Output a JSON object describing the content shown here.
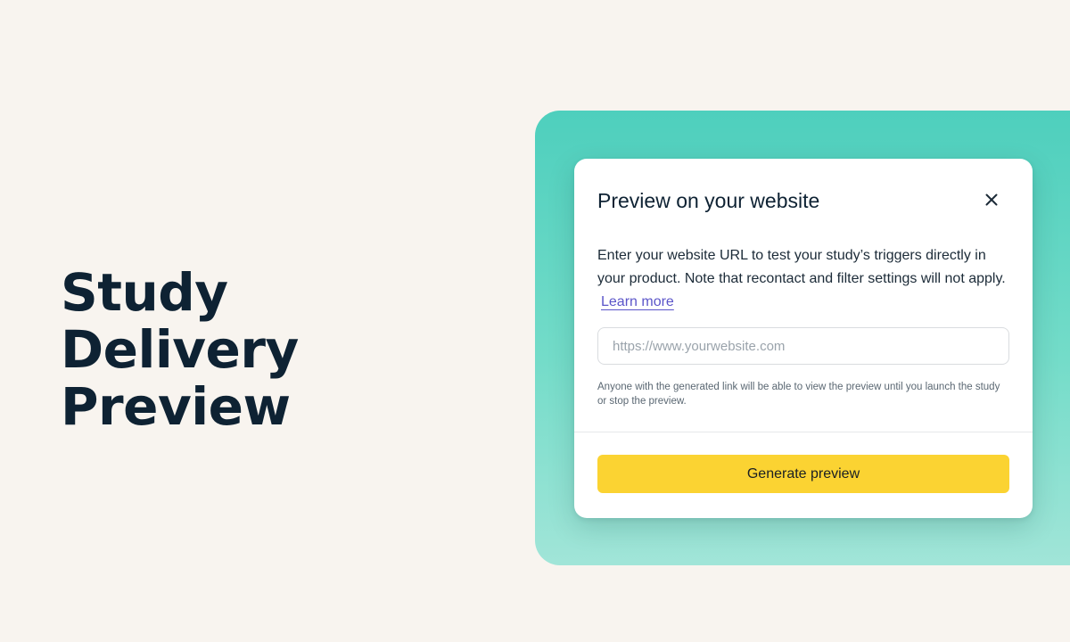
{
  "hero": {
    "title": "Study Delivery Preview"
  },
  "modal": {
    "title": "Preview on your website",
    "description": "Enter your website URL to test your study’s triggers directly in your product. Note that recontact and filter settings will not apply.",
    "learn_more_label": "Learn more",
    "url_input": {
      "value": "",
      "placeholder": "https://www.yourwebsite.com"
    },
    "helper_text": "Anyone with the generated link will be able to view the preview until you launch the study or stop the preview.",
    "generate_button_label": "Generate preview"
  },
  "colors": {
    "page_background": "#f8f4ef",
    "panel_teal": "#4ecfbd",
    "primary_button": "#fbd332",
    "link": "#5b55c9",
    "text_dark": "#0e2233"
  },
  "icons": {
    "close": "close-icon"
  }
}
